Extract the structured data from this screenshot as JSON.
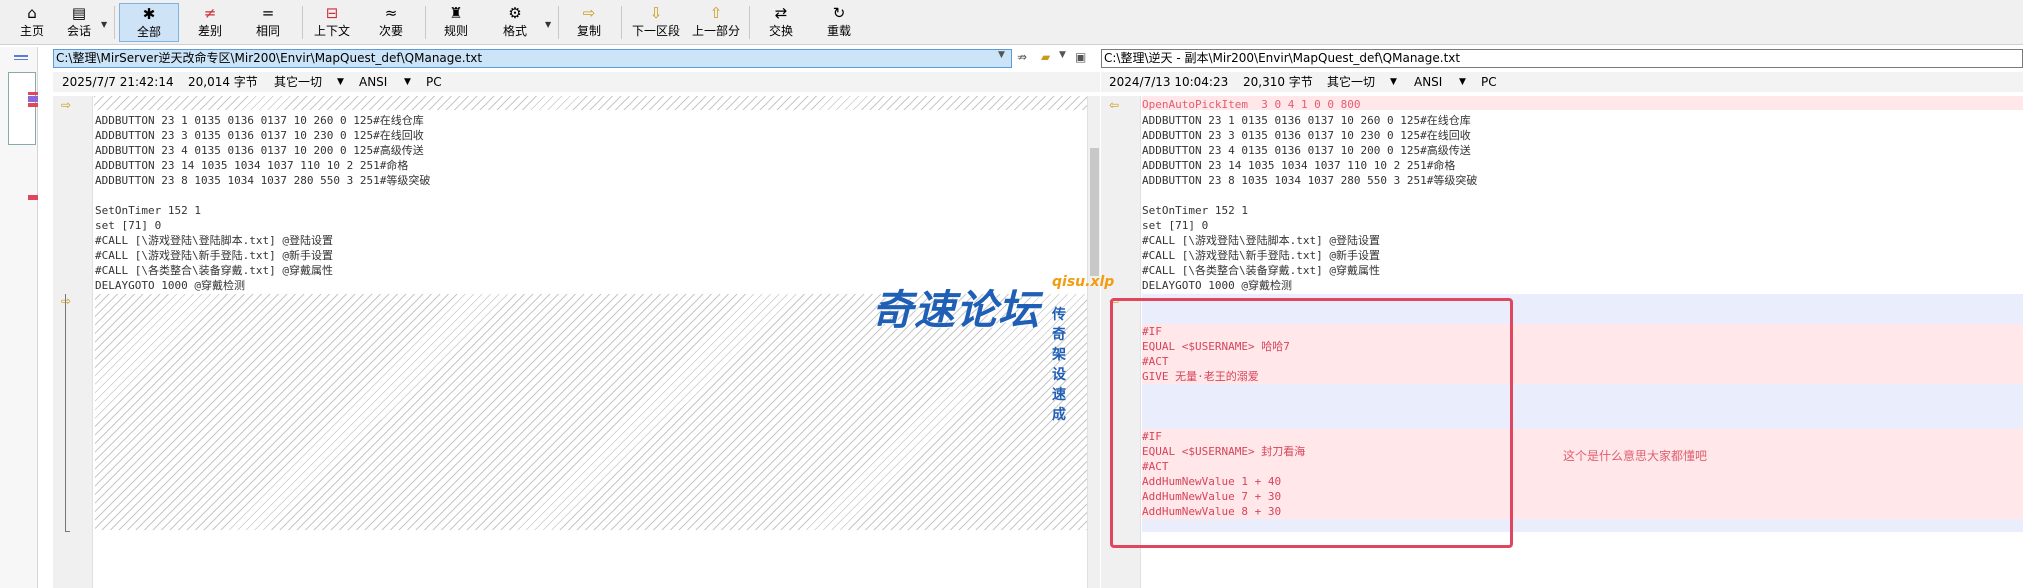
{
  "toolbar": {
    "home": "主页",
    "session": "会话",
    "all": "全部",
    "diff": "差别",
    "same": "相同",
    "context": "上下文",
    "minor": "次要",
    "rules": "规则",
    "format": "格式",
    "copy": "复制",
    "next_section": "下一区段",
    "prev_part": "上一部分",
    "swap": "交换",
    "reload": "重载"
  },
  "left": {
    "path": "C:\\整理\\MirServer逆天改命专区\\Mir200\\Envir\\MapQuest_def\\QManage.txt",
    "date": "2025/7/7 21:42:14",
    "size": "20,014 字节",
    "other": "其它一切",
    "encoding": "ANSI",
    "lineend": "PC",
    "lines": [
      "ADDBUTTON 23 1 0135 0136 0137 10 260 0 125#在线仓库",
      "ADDBUTTON 23 3 0135 0136 0137 10 230 0 125#在线回收",
      "ADDBUTTON 23 4 0135 0136 0137 10 200 0 125#高级传送",
      "ADDBUTTON 23 14 1035 1034 1037 110 10 2 251#命格",
      "ADDBUTTON 23 8 1035 1034 1037 280 550 3 251#等级突破",
      "",
      "SetOnTimer 152 1",
      "set [71] 0",
      "#CALL [\\游戏登陆\\登陆脚本.txt] @登陆设置",
      "#CALL [\\游戏登陆\\新手登陆.txt] @新手设置",
      "#CALL [\\各类整合\\装备穿戴.txt] @穿戴属性",
      "DELAYGOTO 1000 @穿戴检测"
    ]
  },
  "right": {
    "path": "C:\\整理\\逆天 - 副本\\Mir200\\Envir\\MapQuest_def\\QManage.txt",
    "date": "2024/7/13 10:04:23",
    "size": "20,310 字节",
    "other": "其它一切",
    "encoding": "ANSI",
    "lineend": "PC",
    "first_line": "OpenAutoPickItem  3 0 4 1 0 0 800",
    "lines": [
      "ADDBUTTON 23 1 0135 0136 0137 10 260 0 125#在线仓库",
      "ADDBUTTON 23 3 0135 0136 0137 10 230 0 125#在线回收",
      "ADDBUTTON 23 4 0135 0136 0137 10 200 0 125#高级传送",
      "ADDBUTTON 23 14 1035 1034 1037 110 10 2 251#命格",
      "ADDBUTTON 23 8 1035 1034 1037 280 550 3 251#等级突破",
      "",
      "SetOnTimer 152 1",
      "set [71] 0",
      "#CALL [\\游戏登陆\\登陆脚本.txt] @登陆设置",
      "#CALL [\\游戏登陆\\新手登陆.txt] @新手设置",
      "#CALL [\\各类整合\\装备穿戴.txt] @穿戴属性",
      "DELAYGOTO 1000 @穿戴检测"
    ],
    "added_lines": [
      "",
      "#IF",
      "EQUAL <$USERNAME> 哈哈7",
      "#ACT",
      "GIVE 无量·老王的溺爱",
      "",
      "",
      "",
      "#IF",
      "EQUAL <$USERNAME> 封刀看海",
      "#ACT",
      "AddHumNewValue 1 + 40",
      "AddHumNewValue 7 + 30",
      "AddHumNewValue 8 + 30"
    ]
  },
  "watermark": {
    "title": "奇速论坛",
    "site": "qisu.xlp",
    "slogan": "传奇架设速成"
  },
  "annotation": "这个是什么意思大家都懂吧",
  "colors": {
    "diff_pink": "#ffe7ea",
    "diff_text": "#d6455a",
    "blue_band": "#eaeefc",
    "highlight_red": "#e0475f"
  }
}
